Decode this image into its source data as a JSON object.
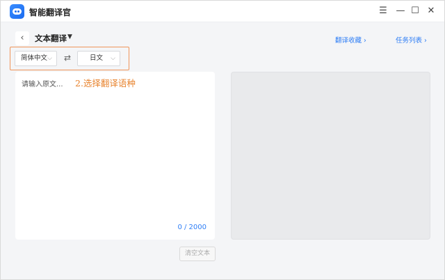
{
  "window": {
    "app_title": "智能翻译官",
    "controls": {
      "menu": "☰",
      "minimize": "—",
      "maximize": "☐",
      "close": "✕"
    }
  },
  "header": {
    "back_glyph": "‹",
    "title": "文本翻译",
    "title_caret": "▼",
    "links": [
      {
        "label": "翻译收藏 ›"
      },
      {
        "label": "任务列表 ›"
      }
    ]
  },
  "languages": {
    "source": "简体中文",
    "target": "日文",
    "chevron": "⌵",
    "swap_glyph": "⇄"
  },
  "input": {
    "placeholder": "请输入原文...",
    "counter": "0 / 2000"
  },
  "annotation": "2.选择翻译语种",
  "actions": {
    "clear_label": "清空文本"
  },
  "colors": {
    "accent": "#2d7df6",
    "annotation": "#e8842f",
    "highlight_border": "#f0955a"
  }
}
